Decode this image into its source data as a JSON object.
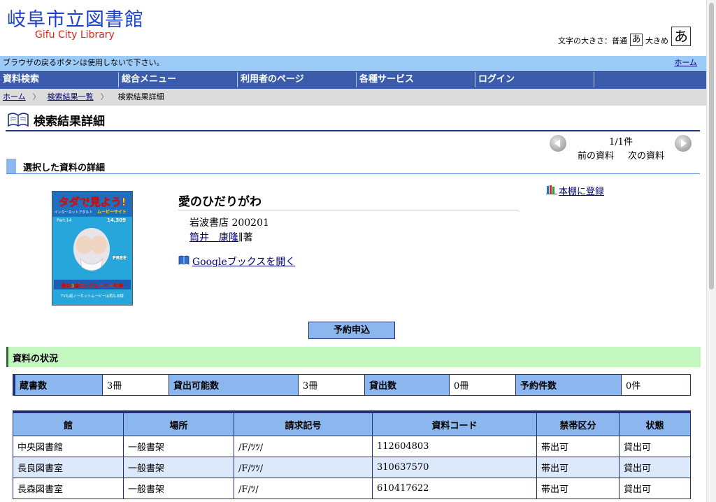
{
  "header": {
    "logo_jp": "岐阜市立図書館",
    "logo_en": "Gifu City Library",
    "fontsize_label": "文字の大きさ：普通",
    "fontsize_normal_glyph": "あ",
    "fontsize_large_label": "大きめ",
    "fontsize_large_glyph": "あ"
  },
  "notice": {
    "message": "ブラウザの戻るボタンは使用しないで下さい。",
    "home_link": "ホーム"
  },
  "nav": {
    "items": [
      "資料検索",
      "総合メニュー",
      "利用者のページ",
      "各種サービス",
      "ログイン"
    ]
  },
  "breadcrumb": {
    "home": "ホーム",
    "sep": "〉",
    "results": "検索結果一覧",
    "current": "検索結果詳細"
  },
  "page": {
    "title": "検索結果詳細"
  },
  "pager": {
    "count": "1/1件",
    "prev": "前の資料",
    "next": "次の資料"
  },
  "section_detail": "選択した資料の詳細",
  "book": {
    "title": "愛のひだりがわ",
    "publisher_date": "岩波書店 200201",
    "author_name": "筒井　康隆",
    "author_role": "∥著",
    "google_link": "Googleブックスを開く",
    "bookshelf_link": "本棚に登録",
    "cover_texts": [
      "タダで見よう!",
      "インターネットアダルト",
      "ムービーサイト",
      "Part.14",
      "14,309",
      "FREE",
      "最新1億ロングムービー特集",
      "TVも超ノーカットムービーは再も収録"
    ]
  },
  "reserve_button": "予約申込",
  "section_status": "資料の状況",
  "counts": [
    {
      "label": "蔵書数",
      "value": "3冊"
    },
    {
      "label": "貸出可能数",
      "value": "3冊"
    },
    {
      "label": "貸出数",
      "value": "0冊"
    },
    {
      "label": "予約件数",
      "value": "0件"
    }
  ],
  "holdings": {
    "headers": [
      "館",
      "場所",
      "請求記号",
      "資料コード",
      "禁帯区分",
      "状態"
    ],
    "rows": [
      [
        "中央図書館",
        "一般書架",
        "/F/ﾂﾂ/",
        "112604803",
        "帯出可",
        "貸出可"
      ],
      [
        "長良図書室",
        "一般書架",
        "/F/ﾂﾂ/",
        "310637570",
        "帯出可",
        "貸出可"
      ],
      [
        "長森図書室",
        "一般書架",
        "/F/ﾂ/",
        "610417622",
        "帯出可",
        "貸出可"
      ]
    ]
  },
  "colors": {
    "nav_bg": "#3a5cab",
    "notice_bg": "#9ccbf7",
    "header_cell_bg": "#8cb6ee",
    "status_section_bg": "#c4f6c0",
    "logo_blue": "#1a3fd0",
    "logo_red": "#e02020"
  },
  "icons": {
    "page_title": "open-book-icon",
    "pager_prev": "arrow-left-circle-icon",
    "pager_next": "arrow-right-circle-icon",
    "google": "blue-book-icon",
    "bookshelf": "bookshelf-icon"
  }
}
